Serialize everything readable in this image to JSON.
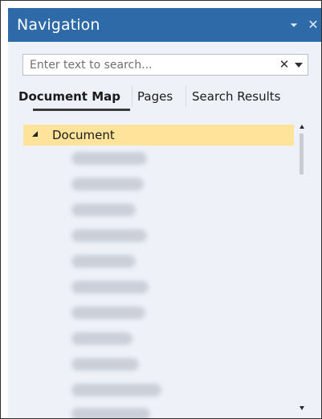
{
  "panel": {
    "title": "Navigation",
    "pin_icon": "pin-icon",
    "close_icon": "close-icon",
    "close_glyph": "✕",
    "pin_glyph": "⊾"
  },
  "search": {
    "placeholder": "Enter text to search...",
    "value": "",
    "clear_glyph": "✕"
  },
  "tabs": [
    {
      "label": "Document Map",
      "active": true
    },
    {
      "label": "Pages",
      "active": false
    },
    {
      "label": "Search Results",
      "active": false
    }
  ],
  "tree": {
    "root_label": "Document",
    "root_expanded": true,
    "child_count_visible": 11
  },
  "colors": {
    "titlebar": "#2d6aa7",
    "panel_bg": "#eef1f8",
    "selected_row": "#fde49a"
  }
}
